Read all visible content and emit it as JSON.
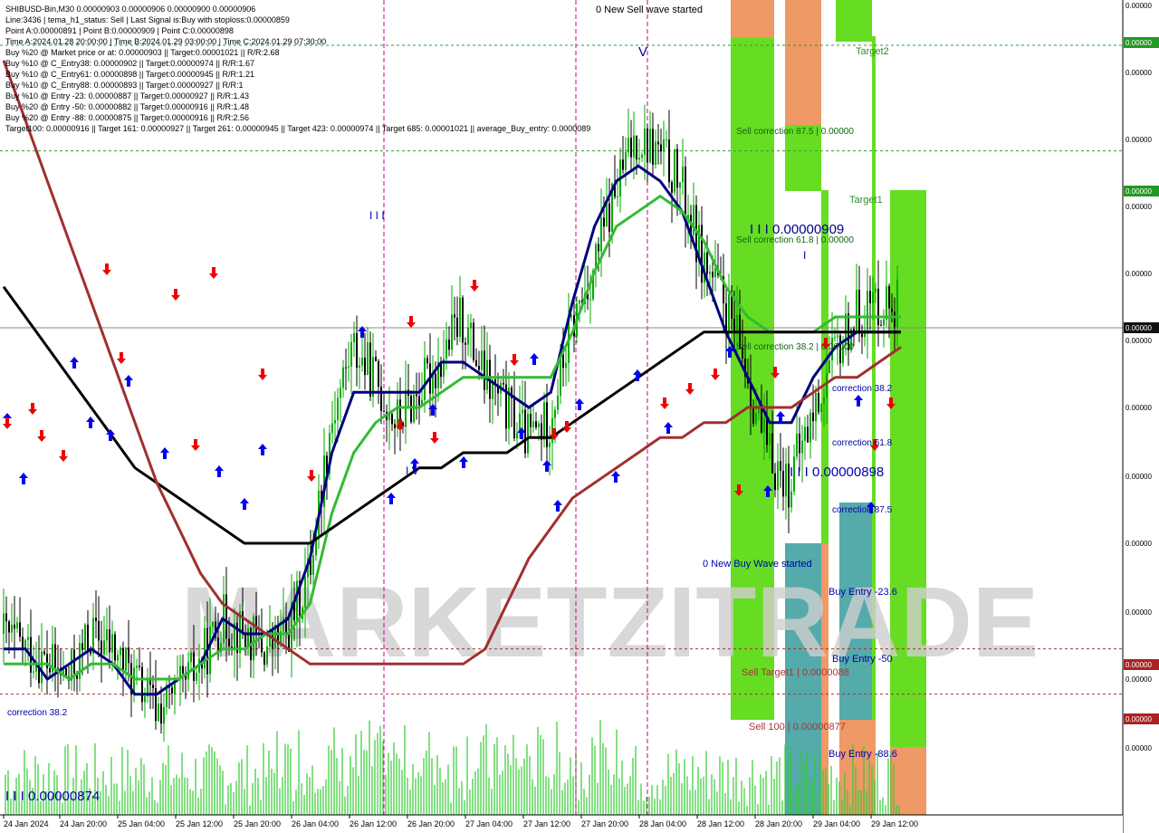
{
  "info_lines": [
    "SHIBUSD-Bin,M30  0.00000903 0.00000906 0.00000900 0.00000906",
    "Line:3436 | tema_h1_status: Sell | Last Signal is:Buy with stoploss:0.00000859",
    "Point A:0.00000891 | Point B:0.00000909 | Point C:0.00000898",
    "Time A:2024.01.28 20:00:00 | Time B:2024.01.29 03:00:00 | Time C:2024.01.29 07:30:00",
    "Buy %20 @ Market price or at: 0.00000903 || Target:0.00001021 || R/R:2.68",
    "Buy %10 @ C_Entry38: 0.00000902 || Target:0.00000974 || R/R:1.67",
    "Buy %10 @ C_Entry61: 0.00000898 || Target:0.00000945 || R/R:1.21",
    "Buy %10 @ C_Entry88: 0.00000893 || Target:0.00000927 || R/R:1",
    "Buy %10 @ Entry -23: 0.00000887 || Target:0.00000927 || R/R:1.43",
    "Buy %20 @ Entry -50: 0.00000882 || Target:0.00000916 || R/R:1.48",
    "Buy %20 @ Entry -88: 0.00000875 || Target:0.00000916 || R/R:2.56",
    "Target100: 0.00000916 || Target 161: 0.00000927 || Target 261: 0.00000945 || Target 423: 0.00000974 || Target 685: 0.00001021 || average_Buy_entry: 0.0000089"
  ],
  "annotations": {
    "new_sell_wave": "0 New Sell wave started",
    "new_buy_wave": "0 New Buy Wave started",
    "sell_corr_875": "Sell correction 87.5 | 0.00000",
    "sell_corr_618": "Sell correction 61.8 | 0.00000",
    "sell_corr_382": "Sell correction 38.2 | 0.00000",
    "point_b": "I I I 0.00000909",
    "point_c": "I I I 0.00000898",
    "point_low": "I I I 0.00000874",
    "correction_382_right": "correction 38.2",
    "correction_618": "correction 61.8",
    "correction_875": "correction 87.5",
    "correction_382_left": "correction 38.2",
    "buy_entry_236": "Buy Entry -23.6",
    "buy_entry_50": "Buy Entry -50",
    "buy_entry_886": "Buy Entry -88.6",
    "sell_target1": "Sell Target1 | 0.0000088",
    "sell_100": "Sell 100 | 0.00000877",
    "target2": "Target2",
    "target1": "Target1",
    "wave_v": "V",
    "wave_iii": "I I I",
    "wave_iv": "I V",
    "wave_i": "I",
    "watermark": "MARKETZITRADE"
  },
  "price_axis": {
    "labels": [
      "0.00000",
      "0.00000",
      "0.00000",
      "0.00000",
      "0.00000",
      "0.00000",
      "0.00000",
      "0.00000",
      "0.00000",
      "0.00000",
      "0.00000",
      "0.00000"
    ],
    "badges": [
      "0.00000",
      "0.00000",
      "0.00000",
      "0.00000",
      "0.00000"
    ]
  },
  "chart_data": {
    "type": "candlestick",
    "symbol": "SHIBUSD-Bin",
    "timeframe": "M30",
    "x_tick_labels": [
      "24 Jan 2024",
      "24 Jan 20:00",
      "25 Jan 04:00",
      "25 Jan 12:00",
      "25 Jan 20:00",
      "26 Jan 04:00",
      "26 Jan 12:00",
      "26 Jan 20:00",
      "27 Jan 04:00",
      "27 Jan 12:00",
      "27 Jan 20:00",
      "28 Jan 04:00",
      "28 Jan 12:00",
      "28 Jan 20:00",
      "29 Jan 04:00",
      "29 Jan 12:00"
    ],
    "ylim": [
      8.69e-06,
      9.23e-06
    ],
    "close_path": [
      8.81e-06,
      8.8e-06,
      8.79e-06,
      8.78e-06,
      8.81e-06,
      8.8e-06,
      8.78e-06,
      8.76e-06,
      8.77e-06,
      8.79e-06,
      8.82e-06,
      8.81e-06,
      8.8e-06,
      8.81e-06,
      8.85e-06,
      8.95e-06,
      9e-06,
      8.98e-06,
      8.95e-06,
      8.97e-06,
      8.99e-06,
      9.02e-06,
      8.98e-06,
      8.96e-06,
      8.94e-06,
      8.95e-06,
      9.01e-06,
      9.05e-06,
      9.1e-06,
      9.14e-06,
      9.13e-06,
      9.11e-06,
      9.06e-06,
      9.03e-06,
      8.99e-06,
      8.93e-06,
      8.91e-06,
      8.95e-06,
      8.99e-06,
      9.02e-06,
      9.03e-06,
      9.03e-06
    ],
    "series": [
      {
        "name": "",
        "color": "#000080",
        "values": [
          8.8e-06,
          8.8e-06,
          8.78e-06,
          8.79e-06,
          8.8e-06,
          8.79e-06,
          8.77e-06,
          8.77e-06,
          8.78e-06,
          8.79e-06,
          8.82e-06,
          8.81e-06,
          8.81e-06,
          8.82e-06,
          8.86e-06,
          8.93e-06,
          8.97e-06,
          8.97e-06,
          8.97e-06,
          8.97e-06,
          8.99e-06,
          8.99e-06,
          8.98e-06,
          8.97e-06,
          8.96e-06,
          8.97e-06,
          9.03e-06,
          9.08e-06,
          9.11e-06,
          9.12e-06,
          9.11e-06,
          9.09e-06,
          9.05e-06,
          9.01e-06,
          8.98e-06,
          8.95e-06,
          8.95e-06,
          8.98e-06,
          9e-06,
          9.01e-06,
          9.01e-06,
          9.01e-06
        ]
      },
      {
        "name": "",
        "color": "#33bb33",
        "values": [
          8.79e-06,
          8.79e-06,
          8.79e-06,
          8.78e-06,
          8.79e-06,
          8.79e-06,
          8.78e-06,
          8.78e-06,
          8.78e-06,
          8.79e-06,
          8.8e-06,
          8.8e-06,
          8.81e-06,
          8.81e-06,
          8.83e-06,
          8.89e-06,
          8.93e-06,
          8.95e-06,
          8.96e-06,
          8.96e-06,
          8.97e-06,
          8.98e-06,
          8.98e-06,
          8.98e-06,
          8.98e-06,
          8.98e-06,
          9.01e-06,
          9.05e-06,
          9.08e-06,
          9.09e-06,
          9.1e-06,
          9.09e-06,
          9.07e-06,
          9.04e-06,
          9.02e-06,
          9.01e-06,
          9.01e-06,
          9.01e-06,
          9.02e-06,
          9.02e-06,
          9.02e-06,
          9.02e-06
        ]
      },
      {
        "name": "",
        "color": "#000000",
        "values": [
          9.04e-06,
          9.02e-06,
          9e-06,
          8.98e-06,
          8.96e-06,
          8.94e-06,
          8.92e-06,
          8.91e-06,
          8.9e-06,
          8.89e-06,
          8.88e-06,
          8.87e-06,
          8.87e-06,
          8.87e-06,
          8.87e-06,
          8.88e-06,
          8.89e-06,
          8.9e-06,
          8.91e-06,
          8.92e-06,
          8.92e-06,
          8.93e-06,
          8.93e-06,
          8.93e-06,
          8.94e-06,
          8.94e-06,
          8.95e-06,
          8.96e-06,
          8.97e-06,
          8.98e-06,
          8.99e-06,
          9e-06,
          9.01e-06,
          9.01e-06,
          9.01e-06,
          9.01e-06,
          9.01e-06,
          9.01e-06,
          9.01e-06,
          9.01e-06,
          9.01e-06,
          9.01e-06
        ]
      },
      {
        "name": "",
        "color": "#a03030",
        "values": [
          9.19e-06,
          9.15e-06,
          9.11e-06,
          9.07e-06,
          9.03e-06,
          8.99e-06,
          8.95e-06,
          8.91e-06,
          8.88e-06,
          8.85e-06,
          8.83e-06,
          8.82e-06,
          8.81e-06,
          8.8e-06,
          8.79e-06,
          8.79e-06,
          8.79e-06,
          8.79e-06,
          8.79e-06,
          8.79e-06,
          8.79e-06,
          8.79e-06,
          8.8e-06,
          8.83e-06,
          8.86e-06,
          8.88e-06,
          8.9e-06,
          8.91e-06,
          8.92e-06,
          8.93e-06,
          8.94e-06,
          8.94e-06,
          8.95e-06,
          8.95e-06,
          8.96e-06,
          8.96e-06,
          8.96e-06,
          8.97e-06,
          8.98e-06,
          8.98e-06,
          8.99e-06,
          9e-06
        ]
      }
    ],
    "levels": [
      {
        "name": "Sell Target1",
        "value": 8.8e-06,
        "color": "#b03030"
      },
      {
        "name": "Sell 100",
        "value": 8.77e-06,
        "color": "#b03030"
      },
      {
        "name": "Target2",
        "value": 9.2e-06,
        "color": "#339933"
      },
      {
        "name": "Target1",
        "value": 9.13e-06,
        "color": "#339933"
      }
    ],
    "grid": false,
    "legend": "none"
  },
  "colors": {
    "bull_candle": "#00aa00",
    "bear_candle": "#000000",
    "buy_arrow": "#0000ee",
    "sell_arrow": "#ee0000",
    "zone_green": "#66dd22",
    "zone_orange": "#ee9966",
    "zone_teal": "#55aaaa",
    "badge_green": "#229922",
    "badge_red": "#aa2222",
    "vline_magenta": "#cc0088",
    "volume": "#33cc33"
  }
}
